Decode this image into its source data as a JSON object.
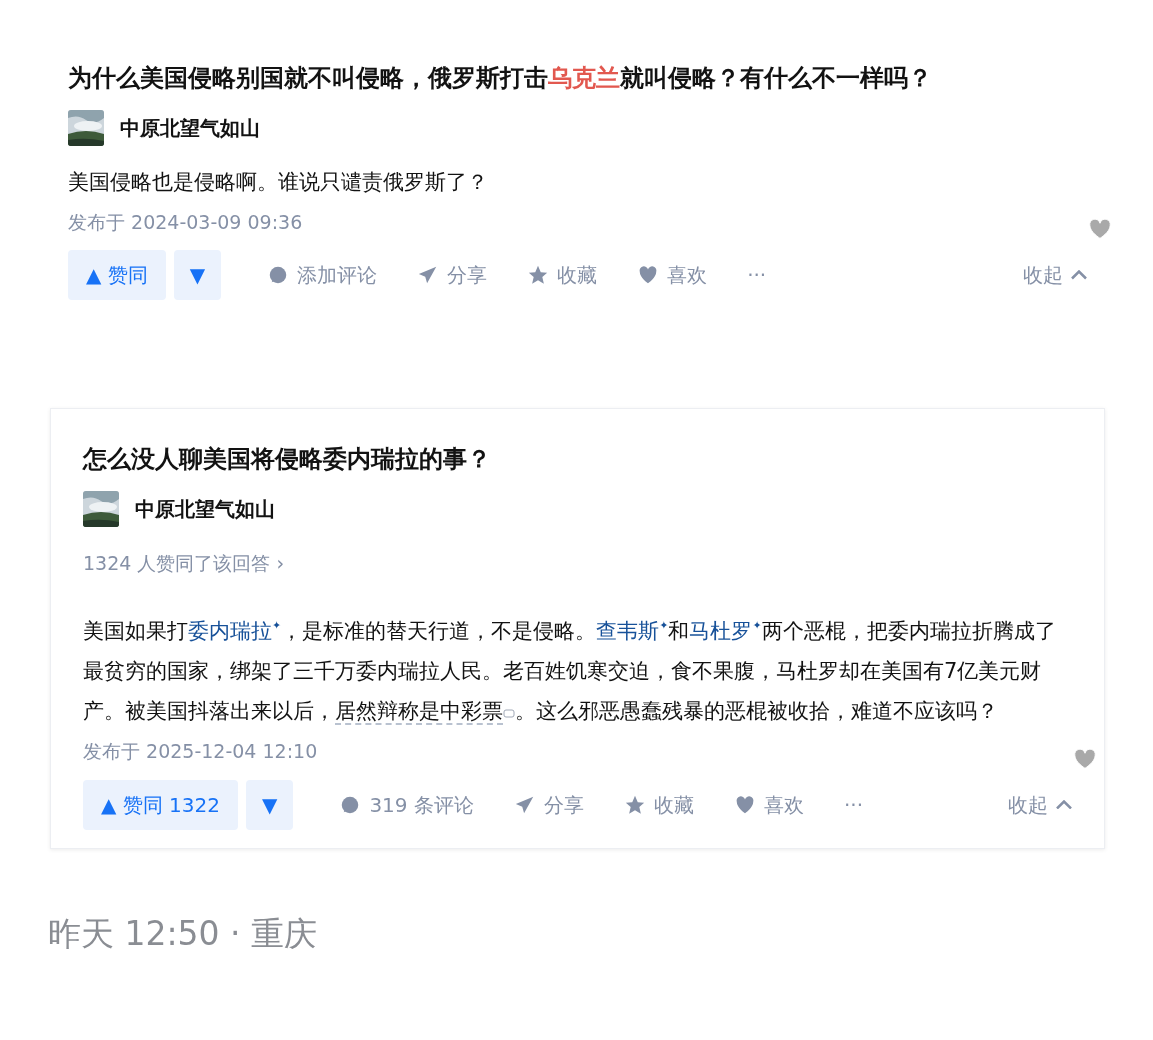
{
  "answers": [
    {
      "title": [
        {
          "text": "为什么美国侵略别国就不叫侵略，俄罗斯打击",
          "highlight": false
        },
        {
          "text": "乌克兰",
          "highlight": true
        },
        {
          "text": "就叫侵略？有什么不一样吗？",
          "highlight": false
        }
      ],
      "author": "中原北望气如山",
      "body": [
        {
          "kind": "text",
          "text": "美国侵略也是侵略啊。谁说只谴责俄罗斯了？"
        }
      ],
      "published": "发布于 2024-03-09 09:36",
      "actions": {
        "upvote": "▲ 赞同",
        "downvote": "▼",
        "comment": "添加评论",
        "share": "分享",
        "collect": "收藏",
        "like": "喜欢",
        "more": "···",
        "collapse": "收起"
      },
      "boxed": false
    },
    {
      "title": [
        {
          "text": "怎么没人聊美国将侵略委内瑞拉的事？",
          "highlight": false
        }
      ],
      "author": "中原北望气如山",
      "upvote_note": "1324 人赞同了该回答 ›",
      "body": [
        {
          "kind": "text",
          "text": "美国如果打"
        },
        {
          "kind": "link",
          "text": "委内瑞拉",
          "suffix": "✦"
        },
        {
          "kind": "text",
          "text": "，是标准的替天行道，不是侵略。"
        },
        {
          "kind": "link",
          "text": "查韦斯",
          "suffix": "✦"
        },
        {
          "kind": "text",
          "text": "和"
        },
        {
          "kind": "link",
          "text": "马杜罗",
          "suffix": "✦"
        },
        {
          "kind": "text",
          "text": "两个恶棍，把委内瑞拉折腾成了最贫穷的国家，绑架了三千万委内瑞拉人民。老百姓饥寒交迫，食不果腹，马杜罗却在美国有7亿美元财产。被美国抖落出来以后，"
        },
        {
          "kind": "annotated",
          "text": "居然辩称是中彩票"
        },
        {
          "kind": "text",
          "text": "。这么邪恶愚蠢残暴的恶棍被收拾，难道不应该吗？"
        }
      ],
      "published": "发布于 2025-12-04 12:10",
      "actions": {
        "upvote": "▲ 赞同 1322",
        "downvote": "▼",
        "comment": "319 条评论",
        "share": "分享",
        "collect": "收藏",
        "like": "喜欢",
        "more": "···",
        "collapse": "收起"
      },
      "boxed": true
    }
  ],
  "footer": "昨天 12:50 · 重庆"
}
